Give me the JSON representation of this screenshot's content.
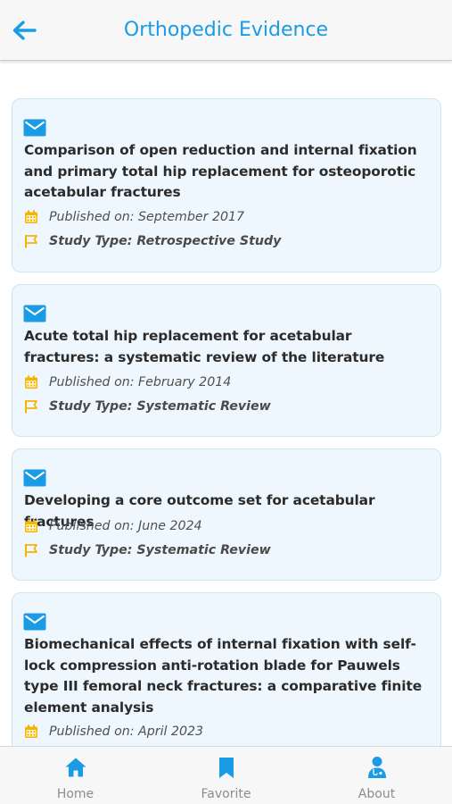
{
  "header": {
    "title": "Orthopedic Evidence",
    "back_icon": "arrow-left-icon"
  },
  "colors": {
    "accent": "#1a9be6",
    "card_bg": "#eef7fd",
    "meta_icon": "#f5b400",
    "nav_icon": "#1a9be6"
  },
  "articles": [
    {
      "icon": "envelope-icon",
      "title": "Comparison of open reduction and internal fixation and primary total hip replacement for osteoporotic acetabular fractures",
      "published": "Published on: September 2017",
      "study_type": "Study Type: Retrospective Study"
    },
    {
      "icon": "envelope-icon",
      "title": "Acute total hip replacement for acetabular fractures: a systematic review of the literature",
      "published": "Published on: February 2014",
      "study_type": "Study Type: Systematic Review"
    },
    {
      "icon": "envelope-icon",
      "title": "Developing a core outcome set for acetabular fractures",
      "published": "Published on: June 2024",
      "study_type": "Study Type: Systematic Review"
    },
    {
      "icon": "envelope-icon",
      "title": "Biomechanical effects of internal fixation with self-lock compression anti-rotation blade for Pauwels type III femoral neck fractures: a comparative finite element analysis",
      "published": "Published on: April 2023",
      "study_type": ""
    }
  ],
  "nav": {
    "home": "Home",
    "favorite": "Favorite",
    "about": "About"
  }
}
